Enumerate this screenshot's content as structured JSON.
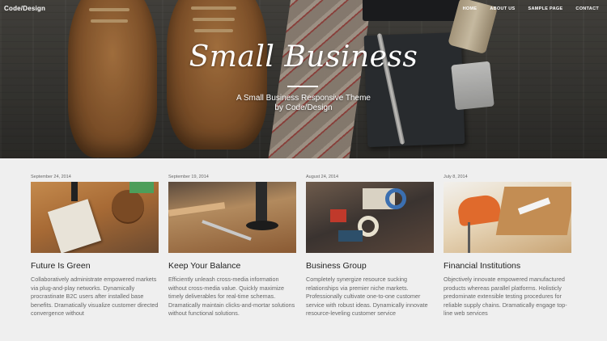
{
  "header": {
    "logo": "Code/Design",
    "nav": [
      "HOME",
      "ABOUT US",
      "SAMPLE PAGE",
      "CONTACT"
    ]
  },
  "hero": {
    "title": "Small Business",
    "subtitle_line1": "A Small Business Responsive Theme",
    "subtitle_line2": "by Code/Design"
  },
  "posts": [
    {
      "date": "September 24, 2014",
      "title": "Future Is Green",
      "excerpt": "Collaboratively administrate empowered markets via plug-and-play networks. Dynamically procrastinate B2C users after installed base benefits. Dramatically visualize customer directed convergence without",
      "image": "desk-with-dont-stop-sign"
    },
    {
      "date": "September 19, 2014",
      "title": "Keep Your Balance",
      "excerpt": "Efficiently unleash cross-media information without cross-media value. Quickly maximize timely deliverables for real-time schemas. Dramatically maintain clicks-and-mortar solutions without functional solutions.",
      "image": "workbench-with-tools"
    },
    {
      "date": "August 24, 2014",
      "title": "Business Group",
      "excerpt": "Completely synergize resource sucking relationships via premier niche markets. Professionally cultivate one-to-one customer service with robust ideas. Dynamically innovate resource-leveling customer service",
      "image": "letterpress-blocks"
    },
    {
      "date": "July 8, 2014",
      "title": "Financial Institutions",
      "excerpt": "Objectively innovate empowered manufactured products whereas parallel platforms. Holisticly predominate extensible testing procedures for reliable supply chains. Dramatically engage top-line web services",
      "image": "office-desk-orange-chair"
    }
  ]
}
